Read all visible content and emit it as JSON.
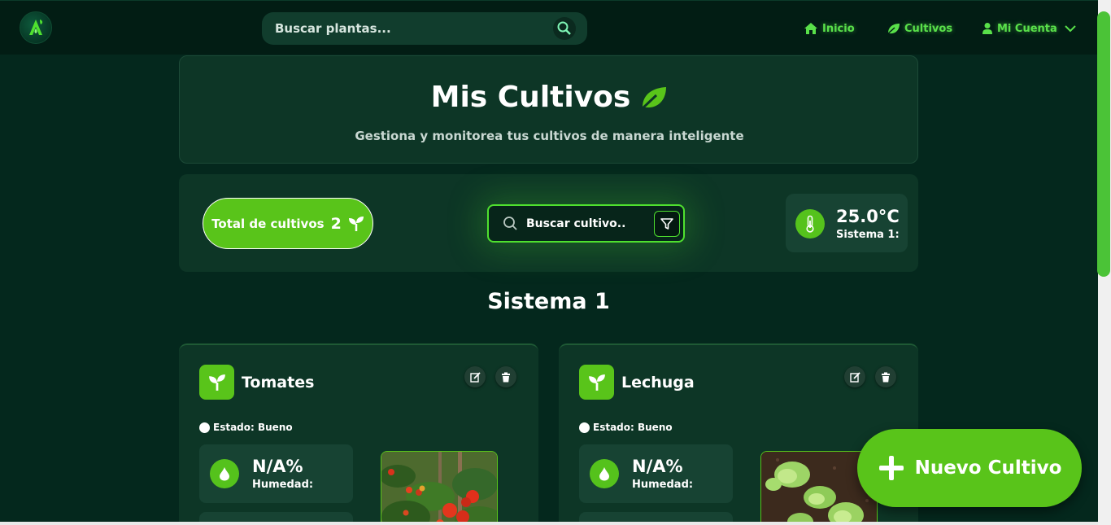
{
  "navbar": {
    "search_placeholder": "Buscar plantas...",
    "links": {
      "home": "Inicio",
      "crops": "Cultivos",
      "account": "Mi Cuenta"
    }
  },
  "header": {
    "title": "Mis Cultivos",
    "subtitle": "Gestiona y monitorea tus cultivos de manera inteligente"
  },
  "toolbar": {
    "total_label": "Total de cultivos",
    "total_count": "2",
    "search_placeholder": "Buscar cultivo..",
    "temperature": "25.0°C",
    "temperature_label": "Sistema 1:"
  },
  "section": {
    "title": "Sistema 1"
  },
  "crops": [
    {
      "name": "Tomates",
      "status": "Estado: Bueno",
      "humidity_value": "N/A%",
      "humidity_label": "Humedad:",
      "image": "tomato-plant"
    },
    {
      "name": "Lechuga",
      "status": "Estado: Bueno",
      "humidity_value": "N/A%",
      "humidity_label": "Humedad:",
      "image": "lettuce-plant"
    }
  ],
  "fab": {
    "label": "Nuevo Cultivo"
  },
  "colors": {
    "background": "#04281d",
    "accent": "#59c41a",
    "glow": "#4fe12f",
    "card": "#0d3626"
  }
}
